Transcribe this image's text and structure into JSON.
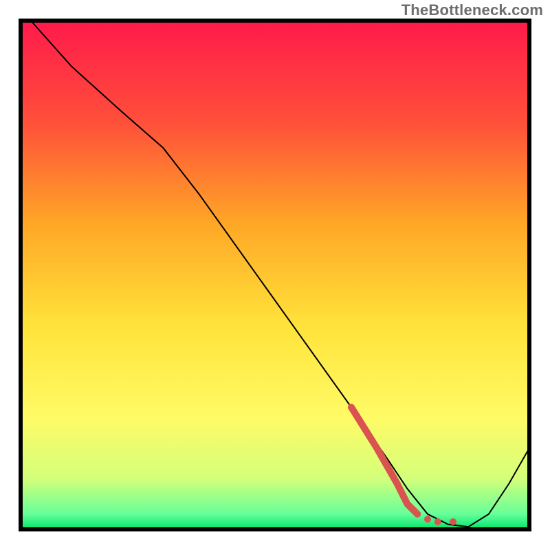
{
  "watermark": "TheBottleneck.com",
  "chart_data": {
    "type": "line",
    "title": "",
    "xlabel": "",
    "ylabel": "",
    "xlim": [
      0,
      100
    ],
    "ylim": [
      0,
      100
    ],
    "grid": false,
    "legend": false,
    "background_gradient": {
      "stops": [
        {
          "offset": 0.0,
          "color": "#ff1a4b"
        },
        {
          "offset": 0.2,
          "color": "#ff4f3a"
        },
        {
          "offset": 0.4,
          "color": "#ffa726"
        },
        {
          "offset": 0.6,
          "color": "#ffe33a"
        },
        {
          "offset": 0.78,
          "color": "#fffb66"
        },
        {
          "offset": 0.9,
          "color": "#d4ff7a"
        },
        {
          "offset": 0.97,
          "color": "#66ff99"
        },
        {
          "offset": 1.0,
          "color": "#00e36b"
        }
      ]
    },
    "series": [
      {
        "name": "bottleneck-curve",
        "color": "#000000",
        "stroke_width": 2,
        "x": [
          2,
          10,
          20,
          28,
          35,
          45,
          55,
          65,
          72,
          76,
          80,
          84,
          88,
          92,
          96,
          100
        ],
        "y": [
          100,
          91,
          82,
          75,
          66,
          52,
          38,
          24,
          14,
          8,
          3,
          1,
          0.5,
          3,
          9,
          16
        ]
      },
      {
        "name": "highlight-segment",
        "color": "#d9534f",
        "stroke_width": 10,
        "style": "solid-then-dotted",
        "x": [
          65,
          70,
          74,
          76,
          78,
          80,
          82,
          85
        ],
        "y": [
          24,
          16,
          9,
          5,
          3,
          2,
          1.5,
          1.5
        ]
      }
    ],
    "annotations": []
  }
}
